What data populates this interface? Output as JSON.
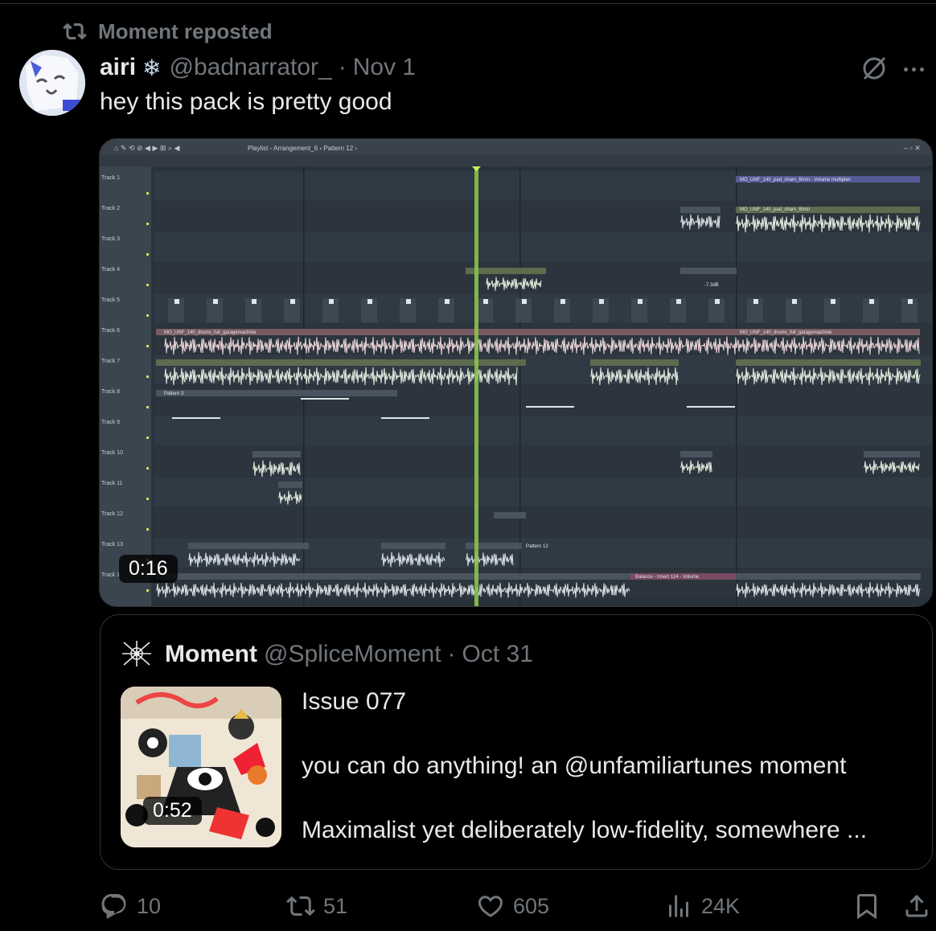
{
  "repost": {
    "label": "Moment reposted"
  },
  "tweet": {
    "name": "airi",
    "name_emoji": "❄",
    "handle": "@badnarrator_",
    "separator": "·",
    "date": "Nov 1",
    "text": "hey this pack is pretty good",
    "video_time": "0:16"
  },
  "daw": {
    "title": "Playlist - Arrangement_6 › Pattern 12 ›",
    "tracks": [
      "Track 1",
      "Track 2",
      "Track 3",
      "Track 4",
      "Track 5",
      "Track 6",
      "Track 7",
      "Track 8",
      "Track 9",
      "Track 10",
      "Track 11",
      "Track 12",
      "Track 13",
      "Track 1"
    ],
    "clip_labels": {
      "vol": "MO_UNF_140_pad_sham_Bmin - Volume multiplier",
      "pad": "MO_UNF_140_pad_sham_Bmin",
      "drums": "MO_UNF_140_drums_full_garagemachine",
      "pattern3": "Pattern 3",
      "pattern12": "Pattern 12",
      "balance": "Balance - Insert 124 - Volume",
      "db": "-7.3dB"
    }
  },
  "quote": {
    "name": "Moment",
    "handle": "@SpliceMoment",
    "separator": "·",
    "date": "Oct 31",
    "video_time": "0:52",
    "line1": "Issue 077",
    "line2": "you can do anything! an @unfamiliartunes moment",
    "line3": "Maximalist yet deliberately low-fidelity, somewhere ..."
  },
  "actions": {
    "replies": "10",
    "reposts": "51",
    "likes": "605",
    "views": "24K"
  },
  "colors": {
    "bg": "#000000",
    "muted": "#71767b",
    "text": "#e7e9ea",
    "border": "#2f3336",
    "daw_bg": "#2a333c",
    "playhead": "#8bc34a"
  }
}
